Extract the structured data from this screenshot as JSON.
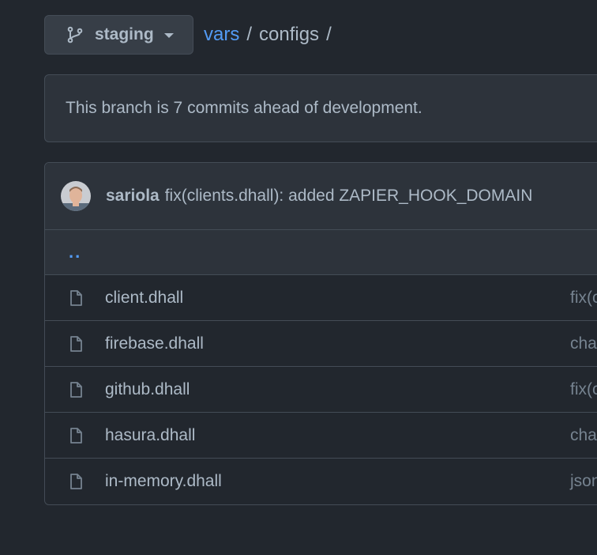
{
  "branch": {
    "icon": "git-branch-icon",
    "name": "staging"
  },
  "breadcrumb": {
    "root": "vars",
    "separator": "/",
    "current": "configs",
    "trailing_separator": "/"
  },
  "ahead_notice": "This branch is 7 commits ahead of development.",
  "latest_commit": {
    "author": "sariola",
    "message": "fix(clients.dhall): added ZAPIER_HOOK_DOMAIN"
  },
  "parent_dir": "..",
  "files": [
    {
      "name": "client.dhall",
      "commit": "fix(c"
    },
    {
      "name": "firebase.dhall",
      "commit": "cha"
    },
    {
      "name": "github.dhall",
      "commit": "fix(c"
    },
    {
      "name": "hasura.dhall",
      "commit": "cha"
    },
    {
      "name": "in-memory.dhall",
      "commit": "json"
    }
  ],
  "colors": {
    "background": "#22272e",
    "link": "#539bf5",
    "text": "#adbac7",
    "muted": "#768390",
    "border": "#444c56"
  }
}
